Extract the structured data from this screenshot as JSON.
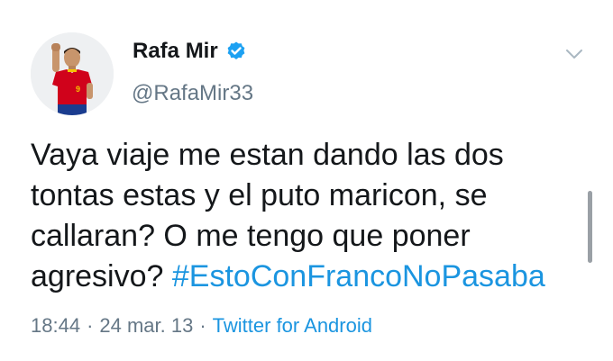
{
  "author": {
    "name": "Rafa Mir",
    "handle": "@RafaMir33",
    "verified": true,
    "avatar_icon": "player-avatar-icon"
  },
  "tweet": {
    "text": "Vaya viaje me estan dando las dos tontas estas y el puto maricon, se callaran? O me tengo que poner agresivo? ",
    "hashtag": "#EstoConFrancoNoPasaba"
  },
  "meta": {
    "time": "18:44",
    "separator_1": "·",
    "date": "24 mar. 13",
    "separator_2": "·",
    "source": "Twitter for Android"
  },
  "colors": {
    "link": "#1b95e0",
    "secondary_text": "#657786",
    "verified_badge": "#1da1f2",
    "jersey_red": "#d0021b"
  },
  "icons": {
    "verified": "verified-badge-icon",
    "menu": "chevron-down-icon"
  }
}
